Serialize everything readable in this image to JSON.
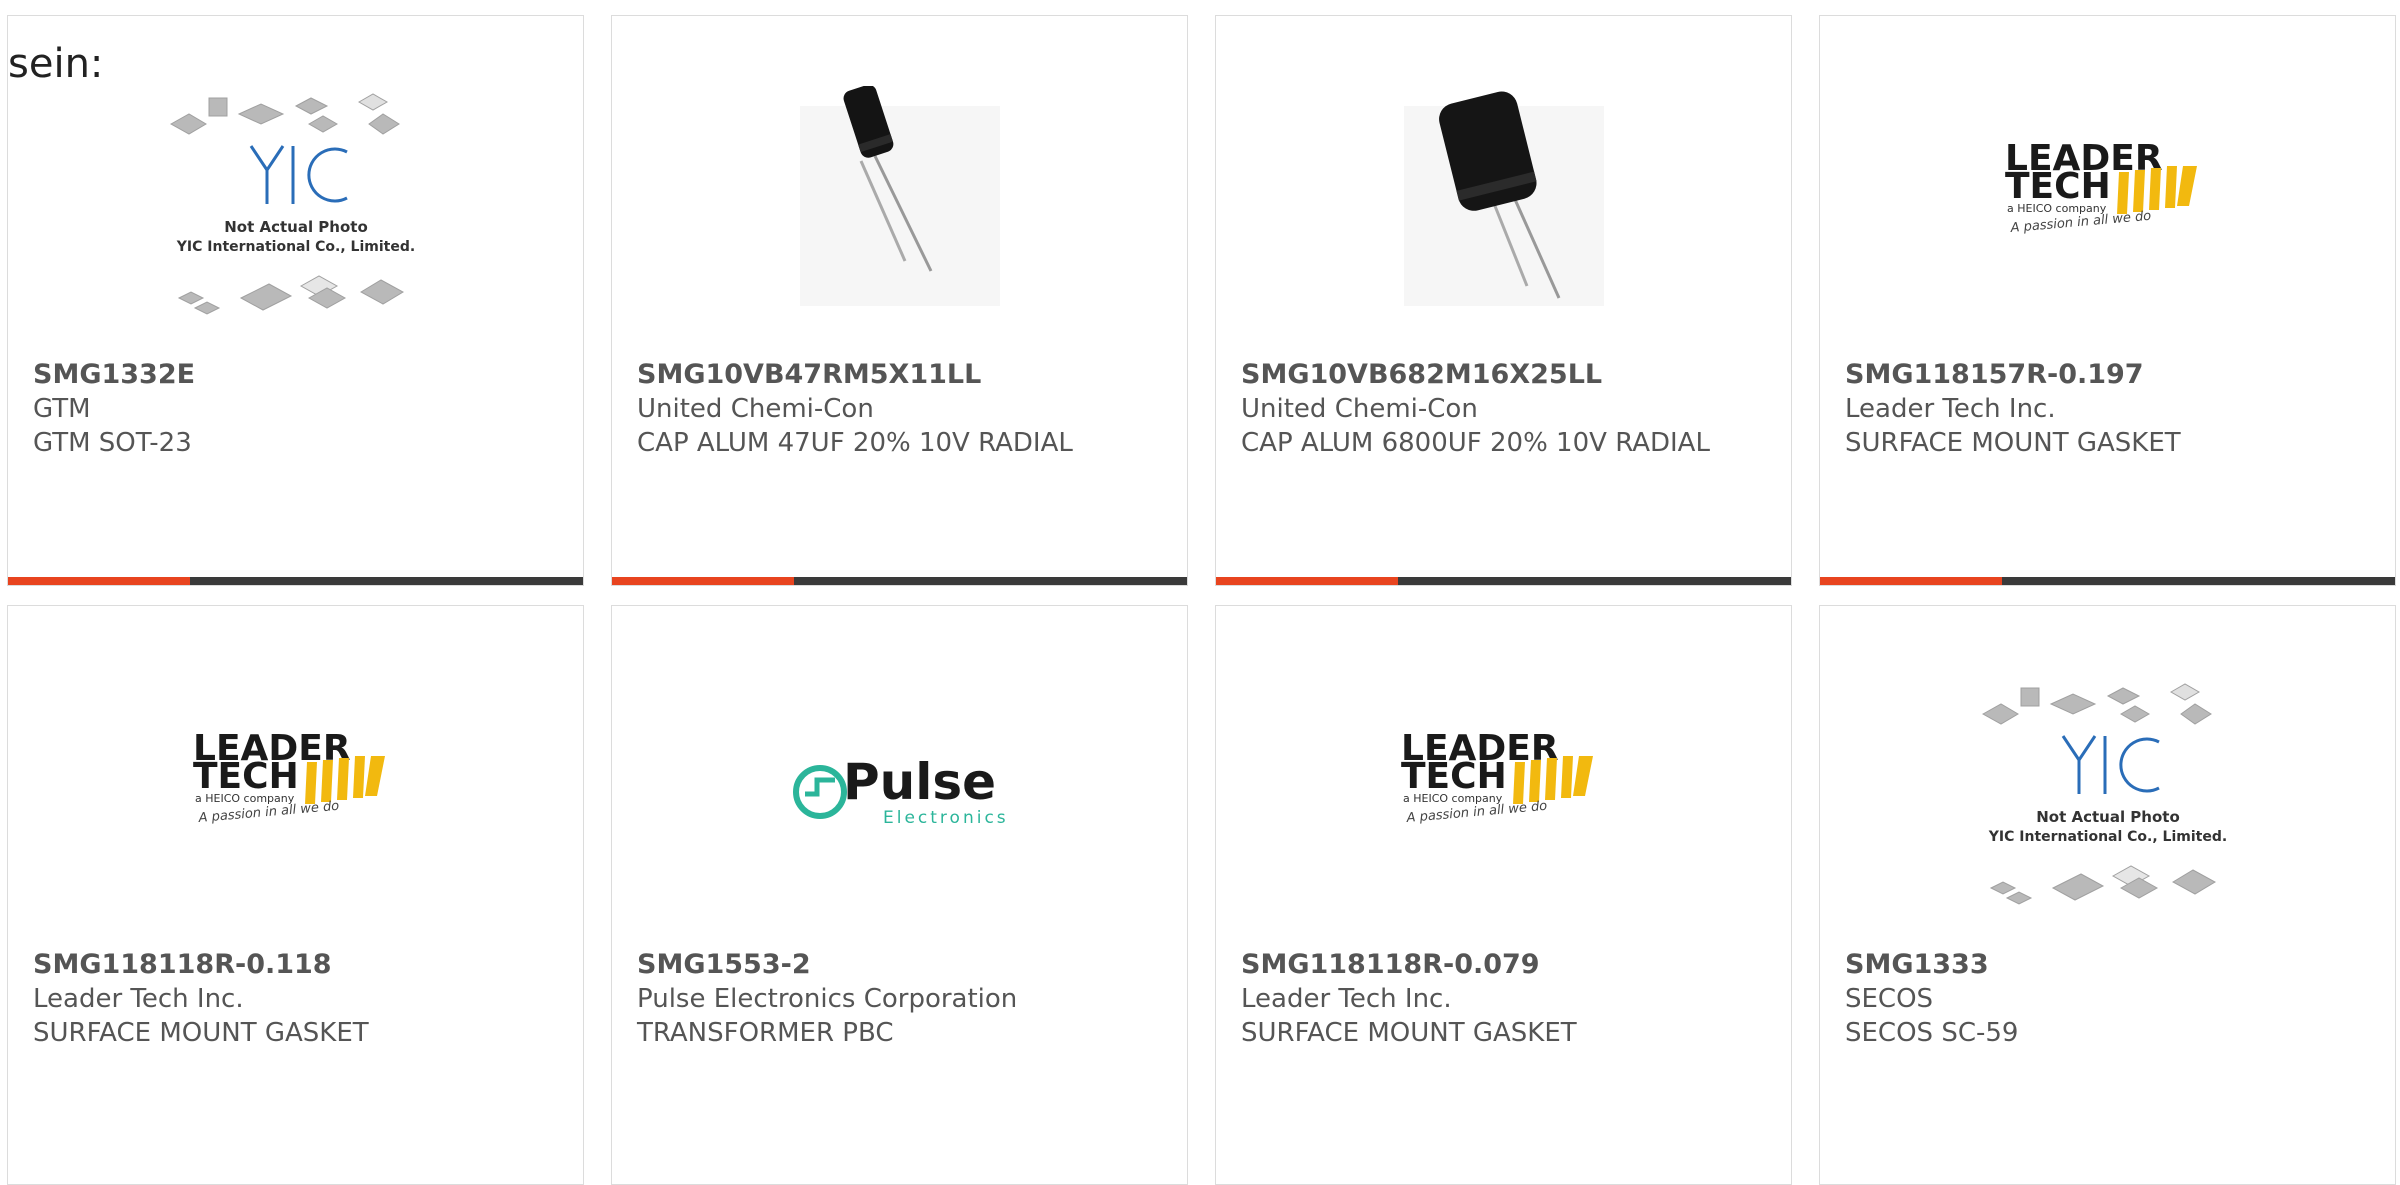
{
  "intro_text": "sein:",
  "colors": {
    "accent": "#e8441f",
    "bar": "#3a3a3a",
    "border": "#dcdcdc",
    "text": "#555555"
  },
  "placeholder_logo": {
    "brand": "YIC",
    "line1": "Not Actual Photo",
    "line2": "YIC International Co., Limited."
  },
  "leadertech_logo": {
    "line1": "LEADER",
    "line2": "TECH",
    "sub": "a HEICO company",
    "tagline": "A passion in all we do"
  },
  "pulse_logo": {
    "name": "Pulse",
    "sub": "Electronics"
  },
  "products": [
    {
      "part": "SMG1332E",
      "manufacturer": "GTM",
      "description": "GTM SOT-23",
      "image": "placeholder-photo"
    },
    {
      "part": "SMG10VB47RM5X11LL",
      "manufacturer": "United Chemi-Con",
      "description": "CAP ALUM 47UF 20% 10V RADIAL",
      "image": "capacitor-small"
    },
    {
      "part": "SMG10VB682M16X25LL",
      "manufacturer": "United Chemi-Con",
      "description": "CAP ALUM 6800UF 20% 10V RADIAL",
      "image": "capacitor-large"
    },
    {
      "part": "SMG118157R-0.197",
      "manufacturer": "Leader Tech Inc.",
      "description": "SURFACE MOUNT GASKET",
      "image": "leadertech-logo"
    },
    {
      "part": "SMG118118R-0.118",
      "manufacturer": "Leader Tech Inc.",
      "description": "SURFACE MOUNT GASKET",
      "image": "leadertech-logo"
    },
    {
      "part": "SMG1553-2",
      "manufacturer": "Pulse Electronics Corporation",
      "description": "TRANSFORMER PBC",
      "image": "pulse-logo"
    },
    {
      "part": "SMG118118R-0.079",
      "manufacturer": "Leader Tech Inc.",
      "description": "SURFACE MOUNT GASKET",
      "image": "leadertech-logo"
    },
    {
      "part": "SMG1333",
      "manufacturer": "SECOS",
      "description": "SECOS SC-59",
      "image": "placeholder-photo"
    }
  ]
}
